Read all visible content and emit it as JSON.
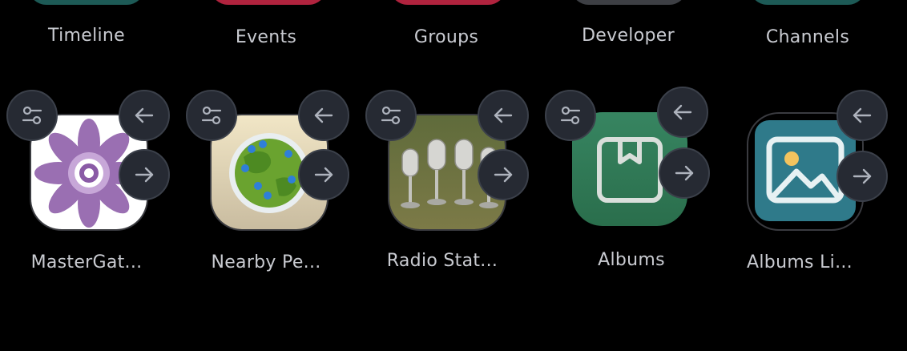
{
  "top_row": [
    {
      "label": "Timeline",
      "color": "#1d5a56"
    },
    {
      "label": "Events",
      "color": "#b0233e"
    },
    {
      "label": "Groups",
      "color": "#b0233e"
    },
    {
      "label": "Developer",
      "color": "#3d3f44"
    },
    {
      "label": "Channels",
      "color": "#1d5a56"
    }
  ],
  "apps": [
    {
      "label": "MasterGat...",
      "icon": "flower-icon"
    },
    {
      "label": "Nearby Pe...",
      "icon": "globe-pins-icon"
    },
    {
      "label": "Radio Stat...",
      "icon": "microphones-icon"
    },
    {
      "label": "Albums",
      "icon": "bookmark-folder-icon",
      "color": "#2f7a56"
    },
    {
      "label": "Albums Li...",
      "icon": "photo-icon",
      "color": "#2f7a8a"
    }
  ],
  "controls": {
    "settings_icon": "sliders-icon",
    "move_left_icon": "arrow-left-icon",
    "move_right_icon": "arrow-right-icon"
  },
  "colors": {
    "background": "#000000",
    "control_bg": "#262a33",
    "label": "#c9cbd1"
  }
}
